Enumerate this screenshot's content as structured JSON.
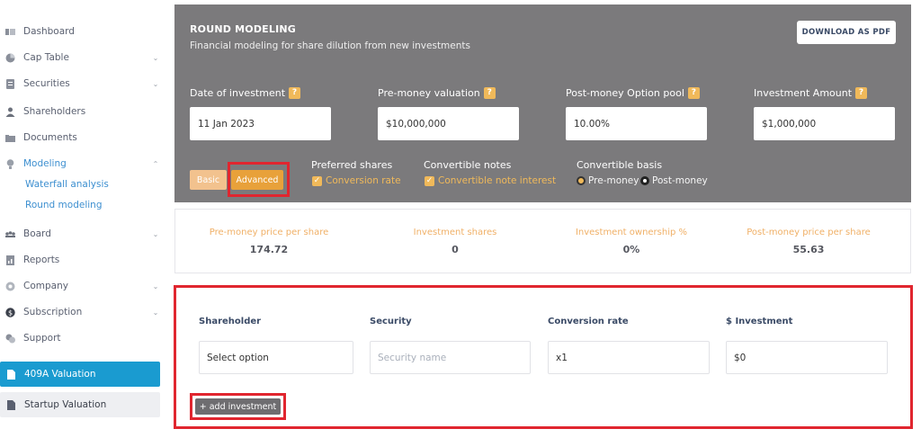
{
  "sidebar": {
    "items": [
      {
        "label": "Dashboard",
        "icon": "dashboard-icon",
        "chevron": false
      },
      {
        "label": "Cap Table",
        "icon": "pie-chart-icon",
        "chevron": true
      },
      {
        "label": "Securities",
        "icon": "securities-icon",
        "chevron": true
      },
      {
        "label": "Shareholders",
        "icon": "person-icon",
        "chevron": false
      },
      {
        "label": "Documents",
        "icon": "folder-icon",
        "chevron": false
      },
      {
        "label": "Modeling",
        "icon": "lightbulb-icon",
        "chevron": true,
        "expanded": true
      },
      {
        "label": "Board",
        "icon": "board-icon",
        "chevron": true
      },
      {
        "label": "Reports",
        "icon": "report-icon",
        "chevron": false
      },
      {
        "label": "Company",
        "icon": "company-icon",
        "chevron": true
      },
      {
        "label": "Subscription",
        "icon": "dollar-icon",
        "chevron": true
      },
      {
        "label": "Support",
        "icon": "support-icon",
        "chevron": false
      }
    ],
    "modeling_subitems": [
      "Waterfall analysis",
      "Round modeling"
    ],
    "valuation_409a": "409A Valuation",
    "startup_valuation": "Startup Valuation"
  },
  "header": {
    "title": "ROUND MODELING",
    "subtitle": "Financial modeling for share dilution from new investments",
    "download_label": "DOWNLOAD AS PDF",
    "fields": [
      {
        "label": "Date of investment",
        "value": "11 Jan 2023"
      },
      {
        "label": "Pre-money valuation",
        "value": "$10,000,000"
      },
      {
        "label": "Post-money Option pool",
        "value": "10.00%"
      },
      {
        "label": "Investment Amount",
        "value": "$1,000,000"
      }
    ],
    "help_glyph": "?",
    "mode_basic": "Basic",
    "mode_advanced": "Advanced",
    "preferred_shares": {
      "heading": "Preferred shares",
      "option": "Conversion rate",
      "checked": true
    },
    "convertible_notes": {
      "heading": "Convertible notes",
      "option": "Convertible note interest",
      "checked": true
    },
    "convertible_basis": {
      "heading": "Convertible basis",
      "options": [
        "Pre-money",
        "Post-money"
      ],
      "selected": "Pre-money"
    }
  },
  "stats": [
    {
      "label": "Pre-money price per share",
      "value": "174.72"
    },
    {
      "label": "Investment shares",
      "value": "0"
    },
    {
      "label": "Investment ownership %",
      "value": "0%"
    },
    {
      "label": "Post-money price per share",
      "value": "55.63"
    }
  ],
  "investments": {
    "columns": [
      "Shareholder",
      "Security",
      "Conversion rate",
      "$ Investment"
    ],
    "row": {
      "shareholder": "Select option",
      "security_placeholder": "Security name",
      "conversion_rate": "x1",
      "investment": "$0"
    },
    "add_label": "+ add investment"
  },
  "colors": {
    "header_bg": "#7b7a7c",
    "accent_orange": "#e8a13a",
    "accent_blue": "#1a9bd0",
    "highlight_red": "#e0262f"
  }
}
